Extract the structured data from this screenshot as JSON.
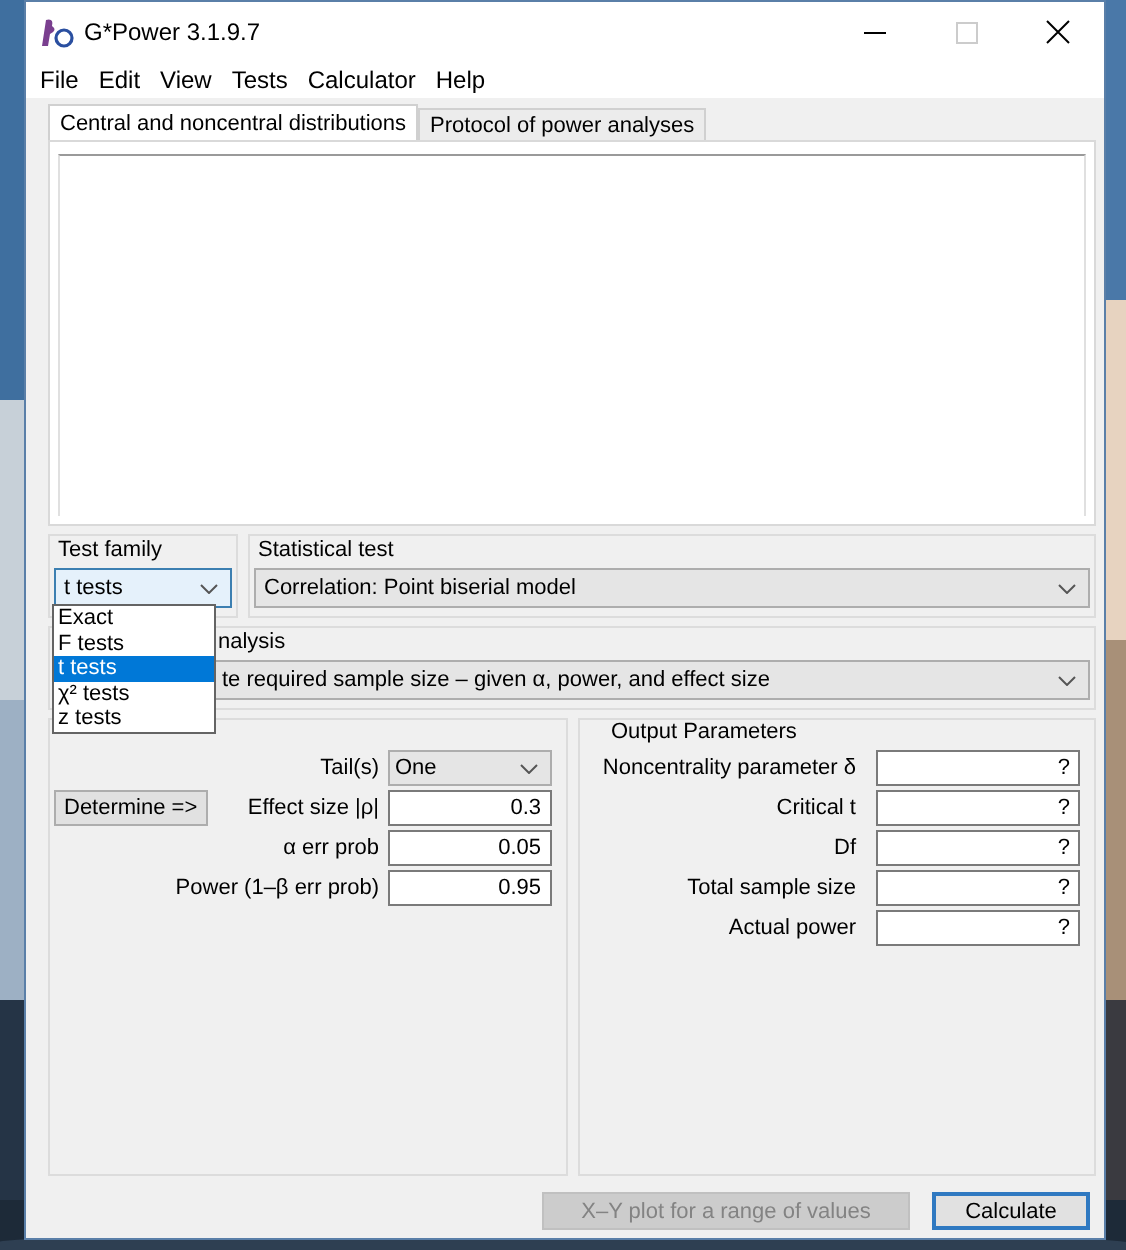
{
  "window": {
    "title": "G*Power 3.1.9.7"
  },
  "menu": [
    "File",
    "Edit",
    "View",
    "Tests",
    "Calculator",
    "Help"
  ],
  "tabs": [
    {
      "label": "Central and noncentral distributions",
      "selected": true
    },
    {
      "label": "Protocol of power analyses",
      "selected": false
    }
  ],
  "test_family": {
    "label": "Test family",
    "value": "t tests",
    "options": [
      {
        "label": "Exact",
        "selected": false
      },
      {
        "label": "F tests",
        "selected": false
      },
      {
        "label": "t tests",
        "selected": true
      },
      {
        "label": "χ² tests",
        "selected": false
      },
      {
        "label": "z tests",
        "selected": false
      }
    ]
  },
  "statistical_test": {
    "label": "Statistical test",
    "value": "Correlation: Point biserial model"
  },
  "type_of_power_analysis": {
    "label": "nalysis",
    "value": "te required sample size – given α, power, and effect size"
  },
  "input_parameters": {
    "determine_button": "Determine =>",
    "fields": [
      {
        "kind": "select",
        "label": "Tail(s)",
        "value": "One"
      },
      {
        "kind": "input",
        "label": "Effect size |ρ|",
        "value": "0.3"
      },
      {
        "kind": "input",
        "label": "α err prob",
        "value": "0.05"
      },
      {
        "kind": "input",
        "label": "Power (1–β err prob)",
        "value": "0.95"
      }
    ]
  },
  "output_parameters": {
    "label": "Output Parameters",
    "fields": [
      {
        "label": "Noncentrality parameter δ",
        "value": "?"
      },
      {
        "label": "Critical t",
        "value": "?"
      },
      {
        "label": "Df",
        "value": "?"
      },
      {
        "label": "Total sample size",
        "value": "?"
      },
      {
        "label": "Actual power",
        "value": "?"
      }
    ]
  },
  "buttons": [
    {
      "label": "X–Y plot for a range of values",
      "disabled": true
    },
    {
      "label": "Calculate",
      "disabled": false
    }
  ]
}
